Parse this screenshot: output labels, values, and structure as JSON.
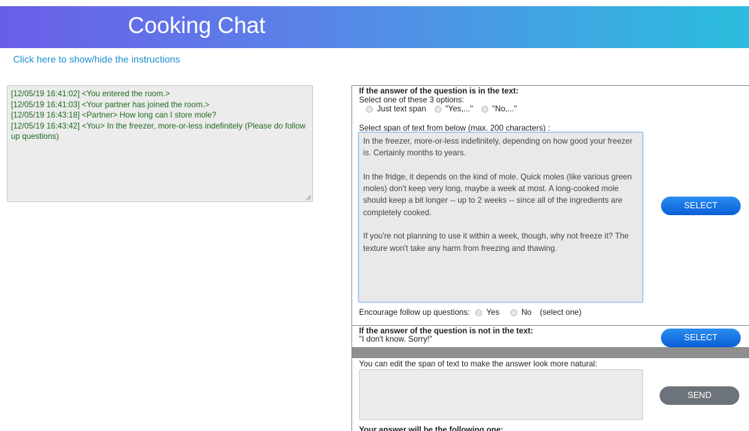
{
  "header": {
    "title": "Cooking Chat",
    "accent_start": "#6a5ee8",
    "accent_end": "#2bbede"
  },
  "instructions_link": "Click here to show/hide the instructions",
  "chat": {
    "lines": [
      "[12/05/19 16:41:02] <You entered the room.>",
      "[12/05/19 16:41:03] <Your partner has joined the room.>",
      "[12/05/19 16:43:18] <Partner> How long can I store mole?",
      "[12/05/19 16:43:42] <You> In the freezer, more-or-less indefinitely (Please do follow up questions)"
    ],
    "text_color": "#1f6a1f"
  },
  "answer_in_text": {
    "heading": "If the answer of the question is in the text:",
    "options_label": "Select one of these 3 options:",
    "options": [
      "Just text span",
      "\"Yes,...\"",
      "\"No,...\""
    ],
    "span_label": "Select span of text from below (max. 200 characters) :",
    "paragraphs": [
      "In the freezer, more-or-less indefinitely, depending on how good your freezer is.  Certainly months to years.",
      "In the fridge, it depends on the kind of mole.  Quick moles (like various green moles) don't keep very long, maybe a week at most.  A long-cooked mole should keep a bit longer -- up to 2 weeks -- since all of the ingredients are completely cooked.",
      "If you're not planning to use it within a week, though, why not freeze it?  The texture won't take any harm from freezing and thawing."
    ],
    "encourage_label": "Encourage follow up questions:",
    "encourage_yes": "Yes",
    "encourage_no": "No",
    "encourage_hint": "(select one)",
    "select_button": "SELECT"
  },
  "answer_not_in_text": {
    "heading": "If the answer of the question is not in the text:",
    "text": "\"I don't know. Sorry!\"",
    "select_button": "SELECT"
  },
  "edit": {
    "label": "You can edit the span of text to make the answer look more natural:",
    "send_button": "SEND",
    "final_label": "Your answer will be the following one:"
  }
}
